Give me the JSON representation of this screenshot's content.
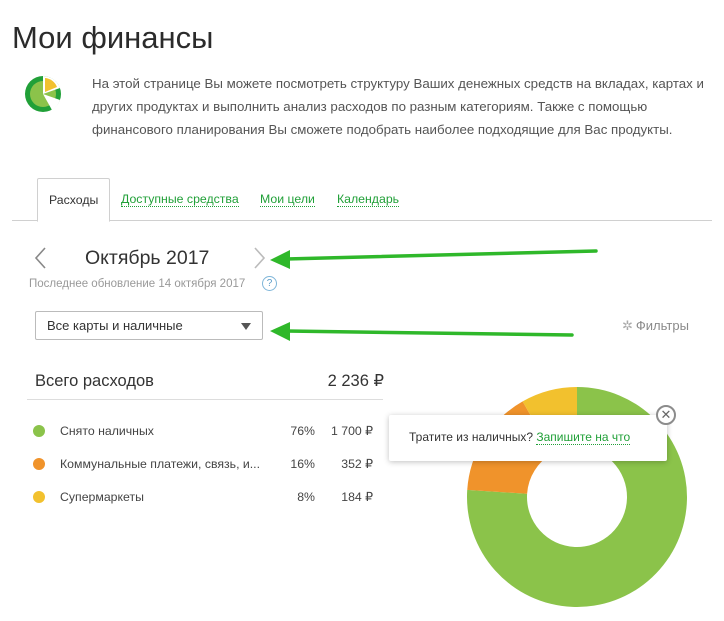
{
  "page": {
    "title": "Мои финансы",
    "intro": "На этой странице Вы можете посмотреть структуру Ваших денежных средств на вкладах, картах и других продуктах и выполнить анализ расходов по разным категориям. Также с помощью финансового планирования Вы сможете подобрать наиболее подходящие для Вас продукты."
  },
  "tabs": [
    {
      "label": "Расходы",
      "active": true
    },
    {
      "label": "Доступные средства",
      "active": false
    },
    {
      "label": "Мои цели",
      "active": false
    },
    {
      "label": "Календарь",
      "active": false
    }
  ],
  "period": {
    "month": "Октябрь 2017",
    "last_update": "Последнее обновление 14 октября 2017",
    "help": "?"
  },
  "filter": {
    "selected": "Все карты и наличные",
    "filters_label": "Фильтры"
  },
  "summary": {
    "total_label": "Всего расходов",
    "total_value": "2 236 ₽"
  },
  "categories": [
    {
      "name": "Снято наличных",
      "percent": "76%",
      "amount": "1 700 ₽",
      "color": "#8bc34a"
    },
    {
      "name": "Коммунальные платежи, связь, и...",
      "percent": "16%",
      "amount": "352 ₽",
      "color": "#f0932b"
    },
    {
      "name": "Супермаркеты",
      "percent": "8%",
      "amount": "184 ₽",
      "color": "#f2c12e"
    }
  ],
  "chart_data": {
    "type": "pie",
    "categories": [
      "Снято наличных",
      "Коммунальные платежи, связь, и...",
      "Супермаркеты"
    ],
    "values": [
      1700,
      352,
      184
    ],
    "colors": [
      "#8bc34a",
      "#f0932b",
      "#f2c12e"
    ]
  },
  "tooltip": {
    "text": "Тратите из наличных?",
    "link": "Запишите на что",
    "close": "✕"
  },
  "colors": {
    "accent": "#21a038",
    "annotation_arrow": "#2fb82a"
  }
}
